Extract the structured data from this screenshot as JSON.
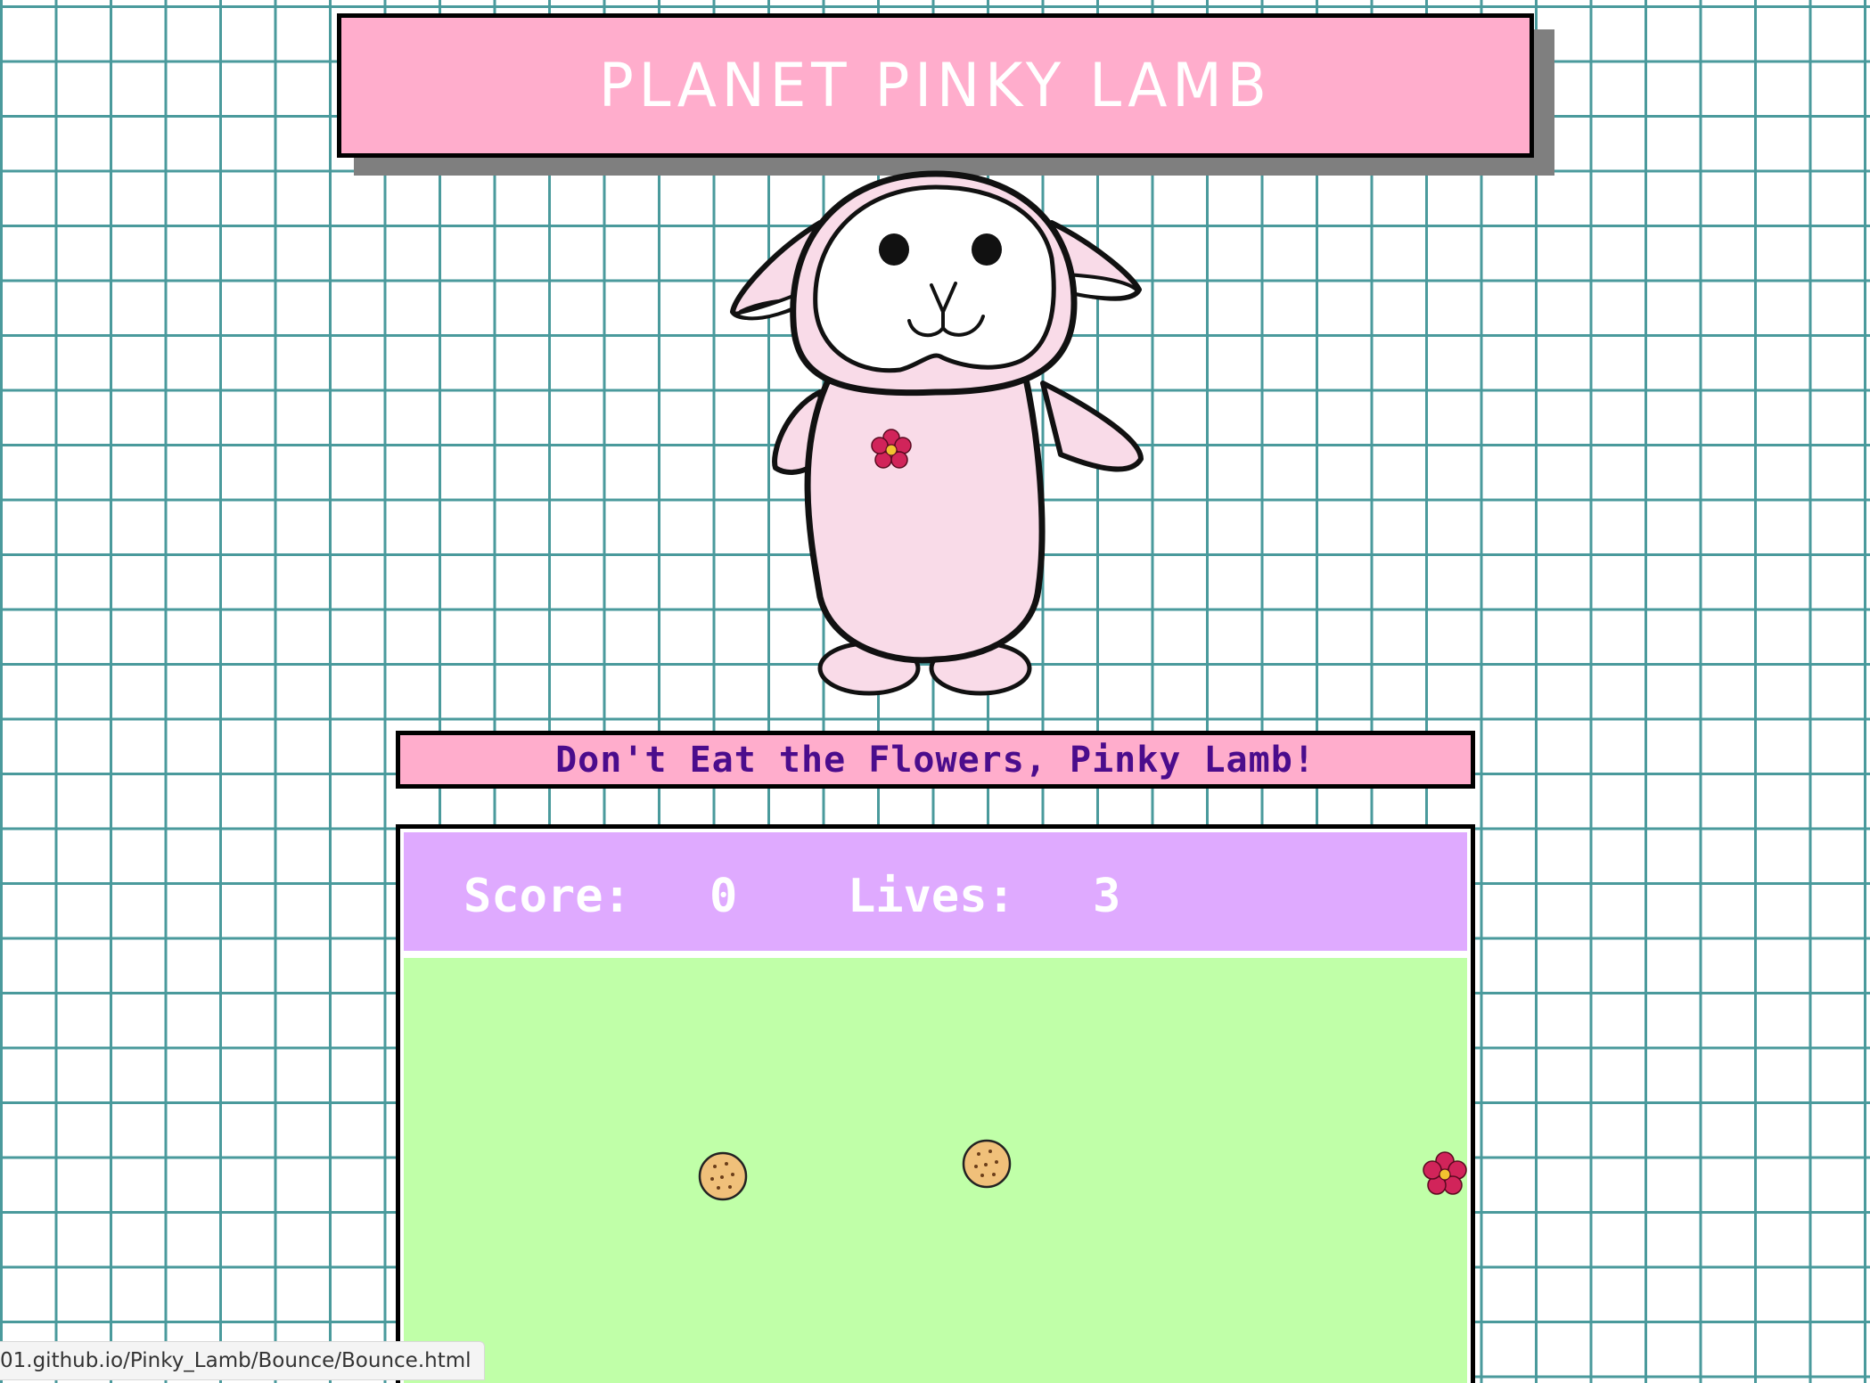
{
  "header": {
    "title": "PLANET PINKY LAMB"
  },
  "game": {
    "subtitle": "Don't Eat the Flowers, Pinky Lamb!",
    "score_label": "Score:",
    "score_value": "0",
    "lives_label": "Lives:",
    "lives_value": "3"
  },
  "status_bar": {
    "url": "01.github.io/Pinky_Lamb/Bounce/Bounce.html"
  },
  "colors": {
    "grid_line": "#4a9a9c",
    "title_bg": "#ffadcc",
    "score_bar_bg": "#dfaaff",
    "field_bg": "#c0ffa8",
    "subtitle_text": "#4b0c8c",
    "flower": "#d1245a"
  },
  "icons": {
    "mascot": "pinky-lamb-icon",
    "cookie": "cookie-icon",
    "flower": "flower-icon"
  }
}
